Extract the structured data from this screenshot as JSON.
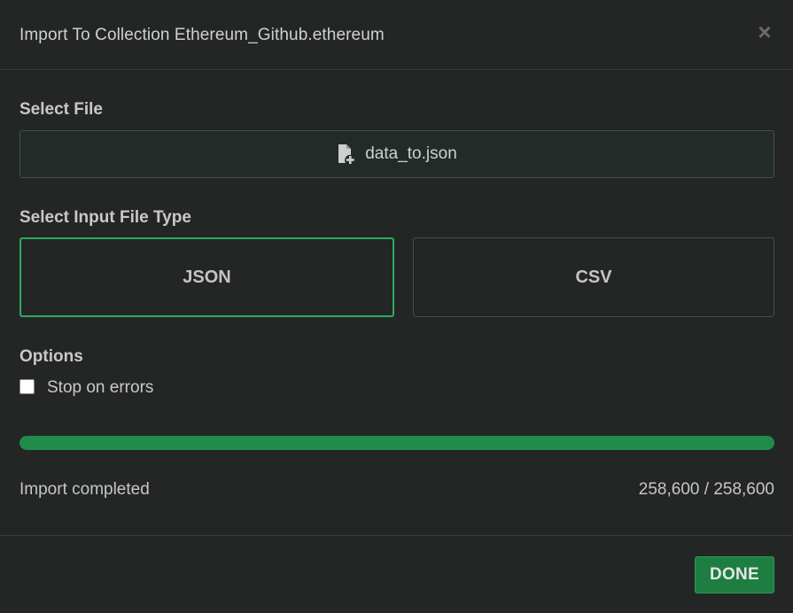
{
  "dialog": {
    "title": "Import To Collection Ethereum_Github.ethereum",
    "close_icon": "close-icon"
  },
  "file_section": {
    "label": "Select File",
    "file_name": "data_to.json",
    "icon": "file-add-icon"
  },
  "type_section": {
    "label": "Select Input File Type",
    "options": [
      {
        "label": "JSON",
        "selected": true
      },
      {
        "label": "CSV",
        "selected": false
      }
    ]
  },
  "options_section": {
    "label": "Options",
    "stop_on_errors": {
      "label": "Stop on errors",
      "checked": false
    }
  },
  "progress": {
    "fraction": 1.0,
    "status": "Import completed",
    "count": "258,600 / 258,600"
  },
  "footer": {
    "done_label": "DONE"
  },
  "colors": {
    "accent": "#2eaa5c",
    "progress": "#1f8c4a",
    "background": "#242626"
  }
}
